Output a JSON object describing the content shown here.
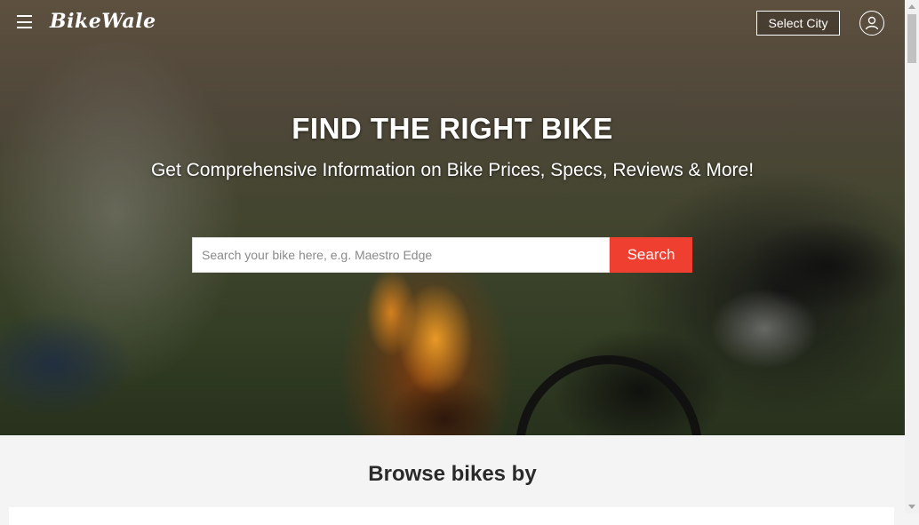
{
  "header": {
    "logo_text": "BikeWale",
    "select_city_label": "Select City"
  },
  "hero": {
    "title": "FIND THE RIGHT BIKE",
    "subtitle": "Get Comprehensive Information on Bike Prices, Specs, Reviews & More!",
    "search": {
      "placeholder": "Search your bike here, e.g. Maestro Edge",
      "value": "",
      "button_label": "Search"
    }
  },
  "browse": {
    "heading": "Browse bikes by"
  },
  "icons": [
    "hamburger-menu-icon",
    "user-account-icon",
    "scroll-up-arrow-icon",
    "scroll-down-arrow-icon"
  ],
  "colors": {
    "search_button": "#ef3f30",
    "page_background": "#f4f4f4"
  }
}
